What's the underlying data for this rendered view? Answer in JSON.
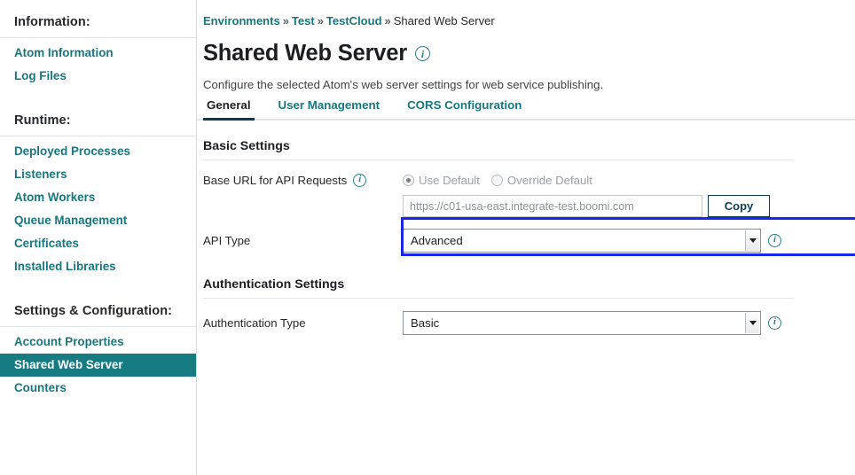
{
  "sidebar": {
    "sections": [
      {
        "heading": "Information:",
        "items": [
          {
            "label": "Atom Information",
            "selected": false
          },
          {
            "label": "Log Files",
            "selected": false
          }
        ]
      },
      {
        "heading": "Runtime:",
        "items": [
          {
            "label": "Deployed Processes",
            "selected": false
          },
          {
            "label": "Listeners",
            "selected": false
          },
          {
            "label": "Atom Workers",
            "selected": false
          },
          {
            "label": "Queue Management",
            "selected": false
          },
          {
            "label": "Certificates",
            "selected": false
          },
          {
            "label": "Installed Libraries",
            "selected": false
          }
        ]
      },
      {
        "heading": "Settings & Configuration:",
        "items": [
          {
            "label": "Account Properties",
            "selected": false
          },
          {
            "label": "Shared Web Server",
            "selected": true
          },
          {
            "label": "Counters",
            "selected": false
          }
        ]
      }
    ]
  },
  "breadcrumb": {
    "items": [
      "Environments",
      "Test",
      "TestCloud"
    ],
    "separator": "»",
    "current": "Shared Web Server"
  },
  "header": {
    "title": "Shared Web Server",
    "info_icon": "info-icon",
    "subtitle": "Configure the selected Atom's web server settings for web service publishing."
  },
  "tabs": [
    {
      "label": "General",
      "active": true
    },
    {
      "label": "User Management",
      "active": false
    },
    {
      "label": "CORS Configuration",
      "active": false
    }
  ],
  "basic_settings": {
    "section_title": "Basic Settings",
    "base_url": {
      "label": "Base URL for API Requests",
      "radio_use_default": "Use Default",
      "radio_override_default": "Override Default",
      "selected": "Use Default",
      "url_value": "https://c01-usa-east.integrate-test.boomi.com",
      "copy_label": "Copy"
    },
    "api_type": {
      "label": "API Type",
      "value": "Advanced",
      "highlighted": true
    }
  },
  "authentication_settings": {
    "section_title": "Authentication Settings",
    "auth_type": {
      "label": "Authentication Type",
      "value": "Basic"
    }
  },
  "colors": {
    "teal": "#177b82",
    "link_teal": "#16777e",
    "highlight_blue": "#1a26e8",
    "navy": "#103d56"
  }
}
